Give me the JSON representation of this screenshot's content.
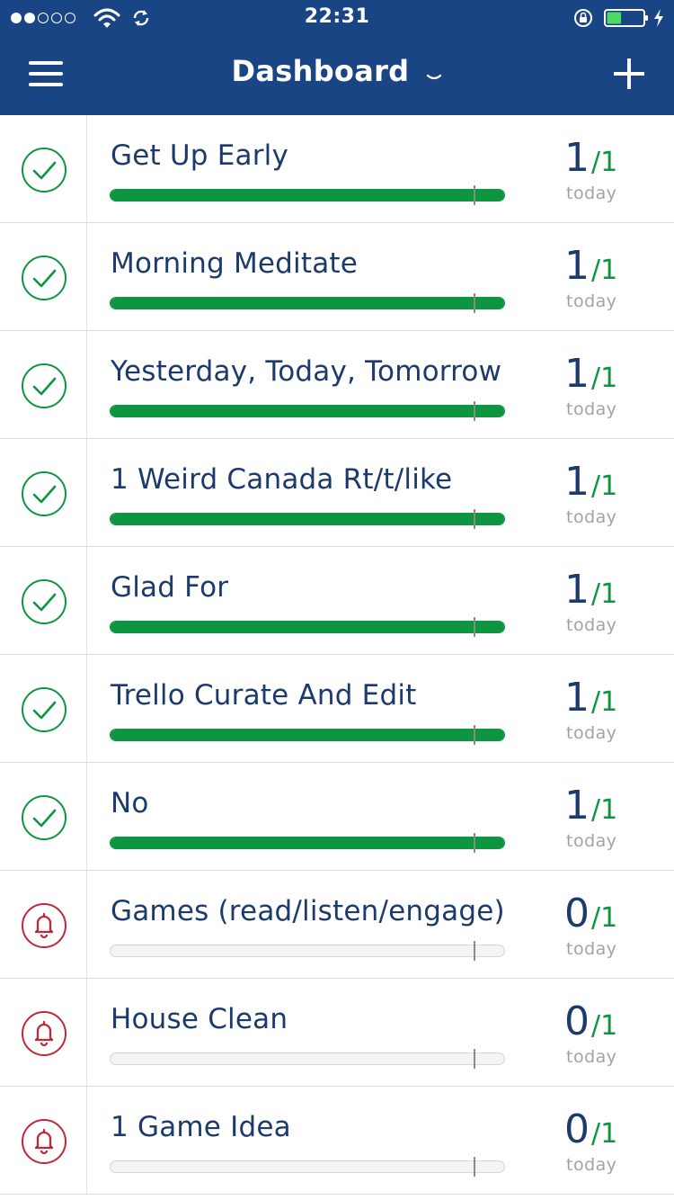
{
  "status_bar": {
    "time": "22:31",
    "signal_dots_filled": 2,
    "signal_dots_total": 5,
    "battery_level": 0.4,
    "icons": [
      "wifi-icon",
      "sync-icon",
      "rotation-lock-icon",
      "battery-icon",
      "charging-icon"
    ]
  },
  "nav": {
    "title": "Dashboard",
    "left_icon": "hamburger-menu-icon",
    "title_icon": "chevron-down-icon",
    "right_icon": "plus-icon"
  },
  "colors": {
    "nav_bg": "#194585",
    "done": "#0f9442",
    "pending": "#c0283a",
    "text": "#1c3a6b",
    "muted": "#a3a3a3"
  },
  "habits": [
    {
      "name": "Get Up Early",
      "done": "1",
      "goal": "/1",
      "period": "today",
      "progress": 1.0,
      "status": "complete"
    },
    {
      "name": "Morning Meditate",
      "done": "1",
      "goal": "/1",
      "period": "today",
      "progress": 1.0,
      "status": "complete"
    },
    {
      "name": "Yesterday, Today, Tomorrow",
      "done": "1",
      "goal": "/1",
      "period": "today",
      "progress": 1.0,
      "status": "complete"
    },
    {
      "name": "1 Weird Canada Rt/t/like",
      "done": "1",
      "goal": "/1",
      "period": "today",
      "progress": 1.0,
      "status": "complete"
    },
    {
      "name": "Glad For",
      "done": "1",
      "goal": "/1",
      "period": "today",
      "progress": 1.0,
      "status": "complete"
    },
    {
      "name": "Trello Curate And Edit",
      "done": "1",
      "goal": "/1",
      "period": "today",
      "progress": 1.0,
      "status": "complete"
    },
    {
      "name": "No",
      "done": "1",
      "goal": "/1",
      "period": "today",
      "progress": 1.0,
      "status": "complete"
    },
    {
      "name": "Games (read/listen/engage)",
      "done": "0",
      "goal": "/1",
      "period": "today",
      "progress": 0.0,
      "status": "reminder"
    },
    {
      "name": "House Clean",
      "done": "0",
      "goal": "/1",
      "period": "today",
      "progress": 0.0,
      "status": "reminder"
    },
    {
      "name": "1 Game Idea",
      "done": "0",
      "goal": "/1",
      "period": "today",
      "progress": 0.0,
      "status": "reminder"
    }
  ]
}
